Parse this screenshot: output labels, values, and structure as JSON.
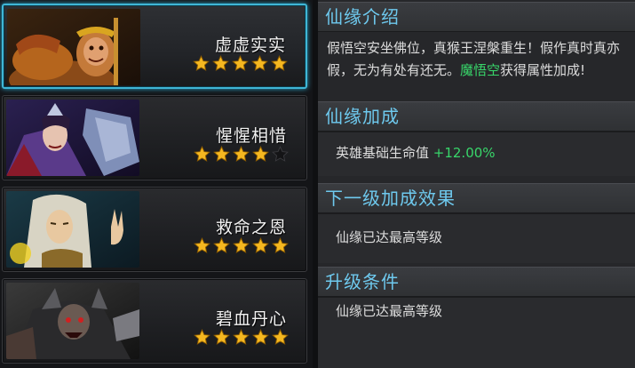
{
  "cards": [
    {
      "name": "虚虚实实",
      "stars": 5,
      "selected": true,
      "portrait": "monkey-king-portrait"
    },
    {
      "name": "惺惺相惜",
      "stars": 4,
      "selected": false,
      "portrait": "armored-knight-portrait"
    },
    {
      "name": "救命之恩",
      "stars": 5,
      "selected": false,
      "portrait": "white-haired-sage-portrait"
    },
    {
      "name": "碧血丹心",
      "stars": 5,
      "selected": false,
      "portrait": "dark-armored-demon-portrait"
    }
  ],
  "sections": {
    "intro": {
      "title": "仙缘介绍",
      "text_before": "假悟空安坐佛位，真猴王涅槃重生！假作真时真亦假，无为有处有还无。",
      "highlight": "魔悟空",
      "text_after": "获得属性加成!"
    },
    "bonus": {
      "title": "仙缘加成",
      "label": "英雄基础生命值 ",
      "value": "+12.00%"
    },
    "next": {
      "title": "下一级加成效果",
      "text": "仙缘已达最高等级"
    },
    "upgrade": {
      "title": "升级条件",
      "text": "仙缘已达最高等级"
    }
  },
  "colors": {
    "title_blue": "#6ec9ee",
    "highlight_green": "#38d66a",
    "selected_border": "#3fb6d6",
    "star_gold": "#f5b820"
  }
}
